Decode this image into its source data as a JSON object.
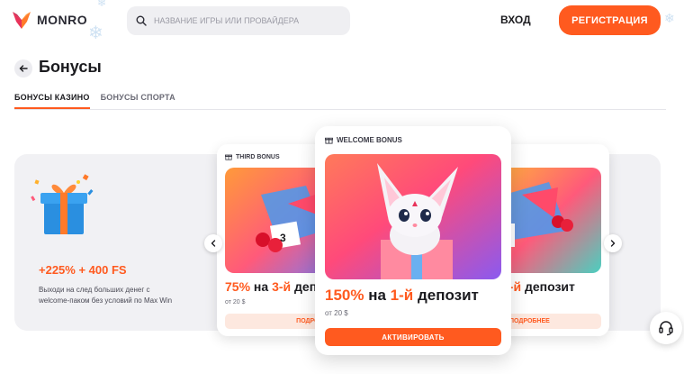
{
  "header": {
    "brand": "MONRO",
    "search_placeholder": "НАЗВАНИЕ ИГРЫ ИЛИ ПРОВАЙДЕРА",
    "login_label": "ВХОД",
    "register_label": "РЕГИСТРАЦИЯ"
  },
  "page": {
    "title": "Бонусы"
  },
  "tabs": [
    {
      "label": "БОНУСЫ КАЗИНО",
      "active": true
    },
    {
      "label": "БОНУСЫ СПОРТА",
      "active": false
    }
  ],
  "promo": {
    "amount": "+225% + 400 FS",
    "description": "Выходи на след больших денег с welcome-паком без условий по Max Win"
  },
  "cards": {
    "left": {
      "label": "THIRD BONUS",
      "percent": "75%",
      "mid": " на ",
      "deposit_number": "3-й",
      "deposit_word": " депозит",
      "min": "от 20 $",
      "more_label": "ПОДРОБНЕЕ",
      "box_number": "3"
    },
    "main": {
      "label": "WELCOME BONUS",
      "percent": "150%",
      "mid": " на ",
      "deposit_number": "1-й",
      "deposit_word": " депозит",
      "min": "от 20 $",
      "activate_label": "АКТИВИРОВАТЬ"
    },
    "right": {
      "deposit_number": "2-й",
      "deposit_word": " депозит",
      "more_label": "ПОДРОБНЕЕ",
      "box_number": "2"
    }
  },
  "colors": {
    "accent": "#ff5a1f",
    "panel_bg": "#f1f1f4",
    "more_bg": "#fde8df"
  },
  "icons": {
    "search": "search-icon",
    "back": "arrow-left-icon",
    "gift": "gift-icon",
    "prev": "chevron-left-icon",
    "next": "chevron-right-icon",
    "support": "headset-icon"
  }
}
